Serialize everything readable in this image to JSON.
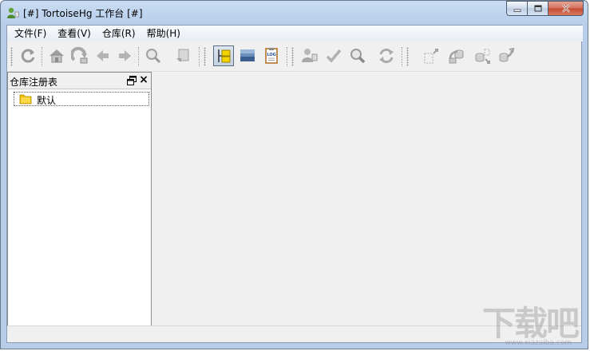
{
  "window": {
    "title": "[#] TortoiseHg 工作台 [#]",
    "minimize_icon": "minimize-icon",
    "maximize_icon": "maximize-icon",
    "close_icon": "close-icon"
  },
  "menu": {
    "items": [
      {
        "label": "文件(F)"
      },
      {
        "label": "查看(V)"
      },
      {
        "label": "仓库(R)"
      },
      {
        "label": "帮助(H)"
      }
    ]
  },
  "toolbar": {
    "groups": [
      [
        "refresh-icon"
      ],
      [
        "home-icon",
        "load-all-icon",
        "back-icon",
        "forward-icon"
      ],
      [
        "filter-icon",
        "goto-icon"
      ],
      [
        "revision-details-icon",
        "commit-icon",
        "log-icon"
      ],
      [
        "sync-incoming-icon",
        "accept-icon",
        "search-icon",
        "recover-icon"
      ],
      [
        "pull-icon",
        "incoming-icon",
        "outgoing-icon",
        "push-icon"
      ]
    ],
    "active": "revision-details-icon"
  },
  "dock": {
    "title": "仓库注册表",
    "tree": [
      {
        "label": "默认",
        "icon": "folder-icon"
      }
    ]
  },
  "status": {
    "text": ""
  },
  "watermark": {
    "text": "下载吧",
    "url": "www.xiazaiba.com"
  },
  "colors": {
    "titlebar": "#b7cde9",
    "client_bg": "#f0f0f0",
    "close_button": "#c44a31",
    "folder": "#f2c200"
  }
}
